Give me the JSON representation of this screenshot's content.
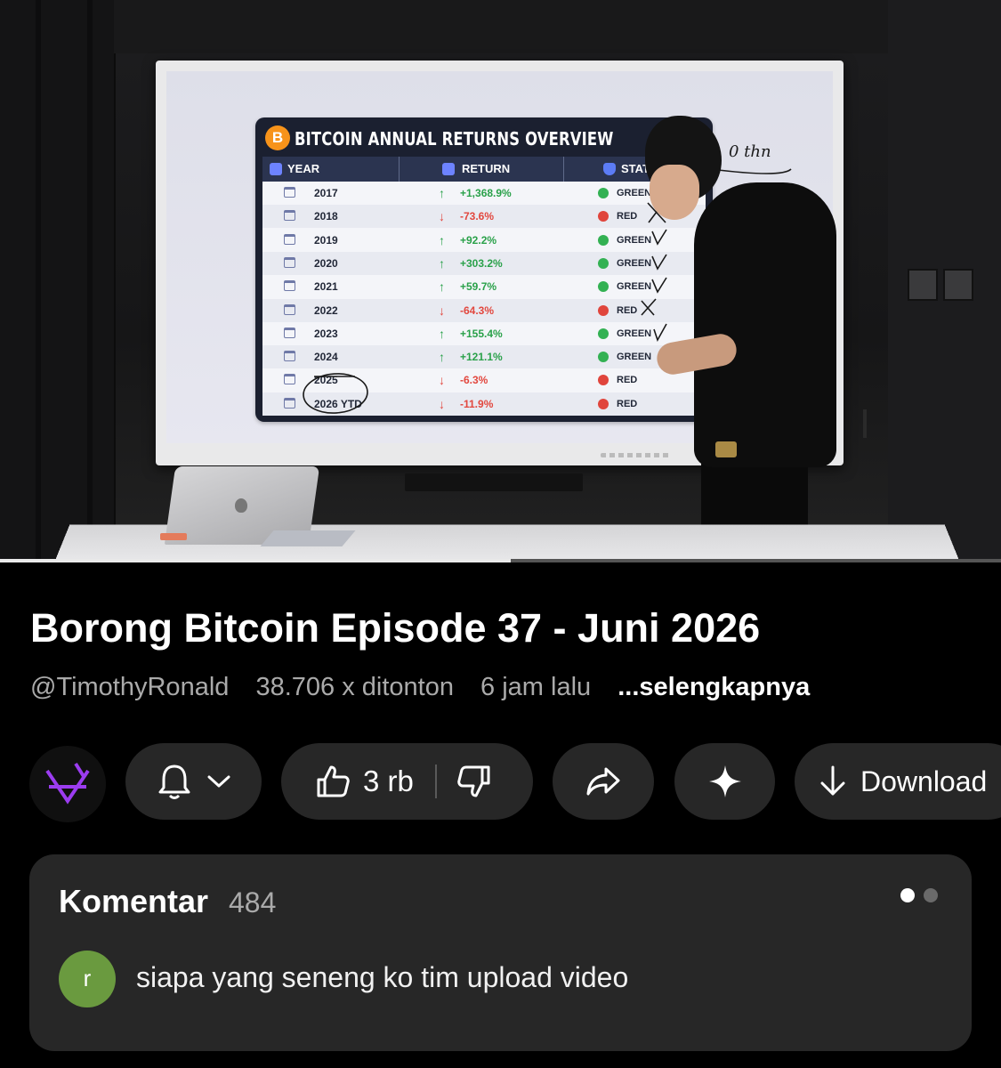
{
  "video": {
    "progress_fraction": 0.51,
    "board": {
      "title": "BITCOIN ANNUAL RETURNS OVERVIEW",
      "coin_symbol": "B",
      "headers": [
        "YEAR",
        "RETURN",
        "STATU"
      ],
      "rows": [
        {
          "year": "2017",
          "return": "+1,368.9%",
          "direction": "up",
          "status": "GREEN"
        },
        {
          "year": "2018",
          "return": "-73.6%",
          "direction": "down",
          "status": "RED"
        },
        {
          "year": "2019",
          "return": "+92.2%",
          "direction": "up",
          "status": "GREEN"
        },
        {
          "year": "2020",
          "return": "+303.2%",
          "direction": "up",
          "status": "GREEN"
        },
        {
          "year": "2021",
          "return": "+59.7%",
          "direction": "up",
          "status": "GREEN"
        },
        {
          "year": "2022",
          "return": "-64.3%",
          "direction": "down",
          "status": "RED"
        },
        {
          "year": "2023",
          "return": "+155.4%",
          "direction": "up",
          "status": "GREEN"
        },
        {
          "year": "2024",
          "return": "+121.1%",
          "direction": "up",
          "status": "GREEN"
        },
        {
          "year": "2025",
          "return": "-6.3%",
          "direction": "down",
          "status": "RED"
        },
        {
          "year": "2026 YTD",
          "return": "-11.9%",
          "direction": "down",
          "status": "RED"
        }
      ],
      "handwriting": "0 thn"
    }
  },
  "title": "Borong Bitcoin Episode 37 - Juni 2026",
  "meta": {
    "channel": "@TimothyRonald",
    "views": "38.706 x ditonton",
    "age": "6 jam lalu",
    "more": "...selengkapnya"
  },
  "actions": {
    "like_count": "3 rb",
    "download_label": "Download"
  },
  "comments": {
    "title": "Komentar",
    "count": "484",
    "first": {
      "avatar_letter": "r",
      "text": "siapa yang seneng ko tim upload video"
    }
  },
  "colors": {
    "accent_purple": "#9b3cf0",
    "green_status": "#33b153",
    "red_status": "#e0453c",
    "comment_avatar": "#6a9a3f"
  }
}
